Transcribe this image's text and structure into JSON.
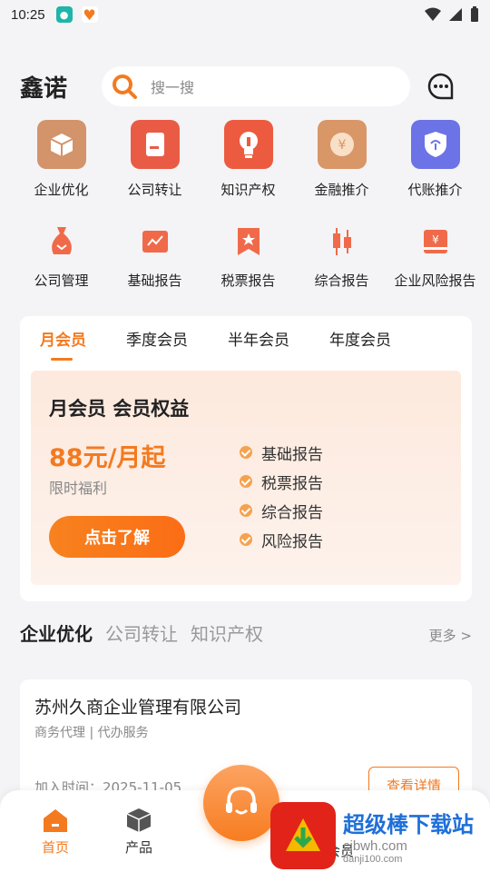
{
  "status_bar": {
    "time": "10:25"
  },
  "header": {
    "brand": "鑫诺",
    "search_placeholder": "搜一搜"
  },
  "services_row1": [
    {
      "label": "企业优化",
      "color": "#d3936b"
    },
    {
      "label": "公司转让",
      "color": "#ea5b45"
    },
    {
      "label": "知识产权",
      "color": "#ec5b3f"
    },
    {
      "label": "金融推介",
      "color": "#d99667"
    },
    {
      "label": "代账推介",
      "color": "#6b73e6"
    }
  ],
  "services_row2": [
    {
      "label": "公司管理"
    },
    {
      "label": "基础报告"
    },
    {
      "label": "税票报告"
    },
    {
      "label": "综合报告"
    },
    {
      "label": "企业风险报告"
    }
  ],
  "membership": {
    "tabs": [
      "月会员",
      "季度会员",
      "半年会员",
      "年度会员"
    ],
    "title": "月会员  会员权益",
    "price": "88元/月起",
    "promo": "限时福利",
    "cta": "点击了解",
    "features": [
      "基础报告",
      "税票报告",
      "综合报告",
      "风险报告"
    ]
  },
  "categories": {
    "tabs": [
      "企业优化",
      "公司转让",
      "知识产权"
    ],
    "more": "更多 >"
  },
  "company": {
    "name": "苏州久商企业管理有限公司",
    "tags": "商务代理 | 代办服务",
    "date": "加入时间：2025-11-05",
    "detail": "查看详情"
  },
  "tabbar": {
    "home": "首页",
    "product": "产品",
    "member": "会员"
  },
  "watermark": {
    "title": "超级棒下载站",
    "sub": "cjbwh.com",
    "sub2": "danji100.com"
  },
  "colors": {
    "accent": "#f47a1f"
  }
}
